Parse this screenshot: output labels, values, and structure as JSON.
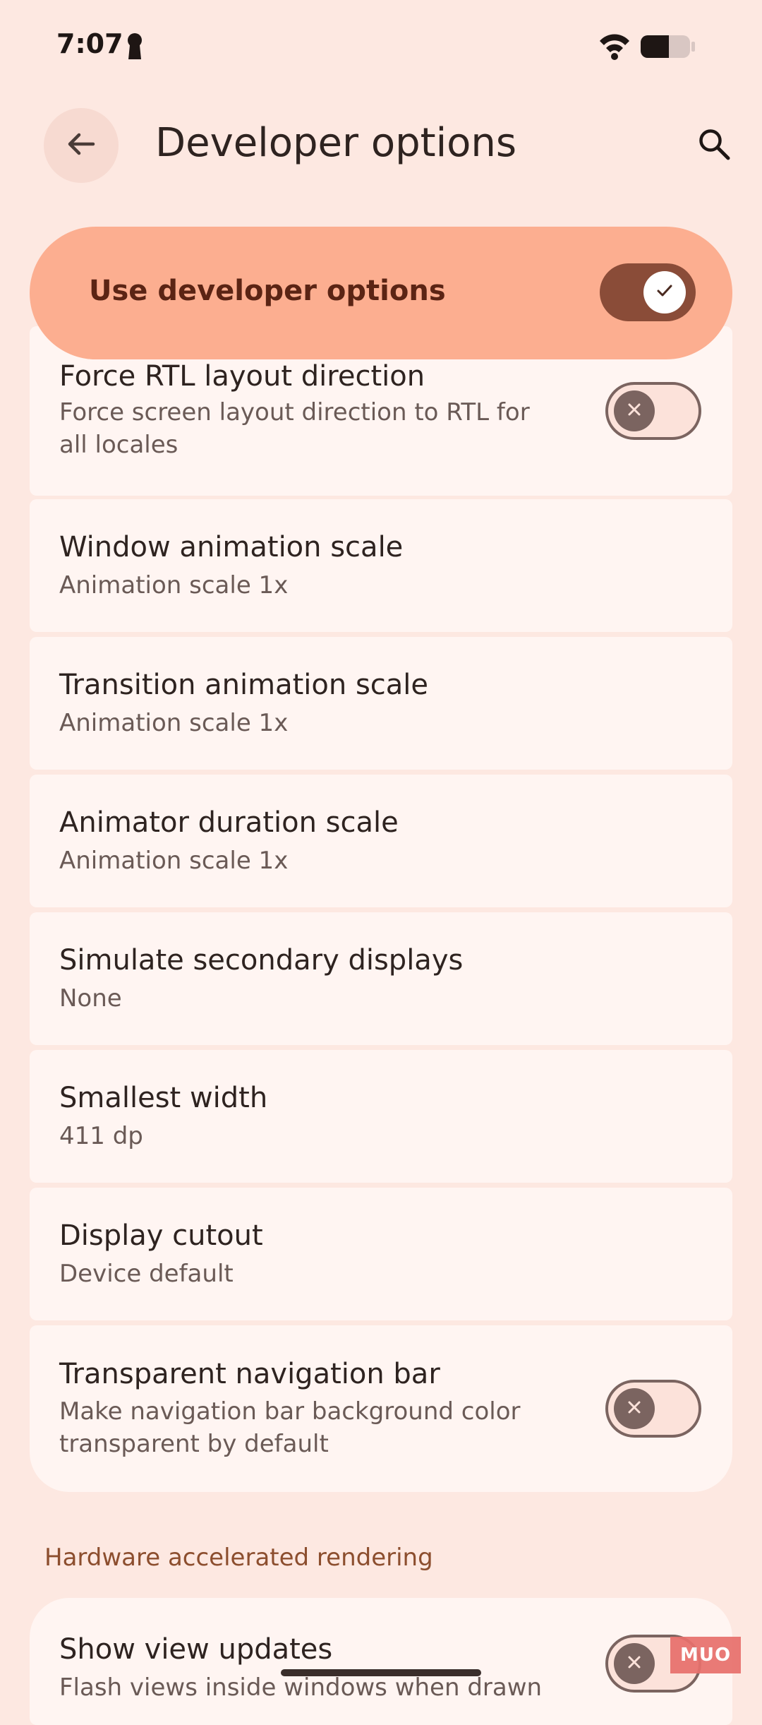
{
  "status_bar": {
    "time": "7:07"
  },
  "header": {
    "title": "Developer options"
  },
  "main_toggle": {
    "label": "Use developer options",
    "state": "on"
  },
  "settings": [
    {
      "title": "Force RTL layout direction",
      "subtitle_lines": [
        "Force screen layout direction to RTL for",
        "all locales"
      ],
      "toggle": "off"
    },
    {
      "title": "Window animation scale",
      "subtitle_lines": [
        "Animation scale 1x"
      ]
    },
    {
      "title": "Transition animation scale",
      "subtitle_lines": [
        "Animation scale 1x"
      ]
    },
    {
      "title": "Animator duration scale",
      "subtitle_lines": [
        "Animation scale 1x"
      ]
    },
    {
      "title": "Simulate secondary displays",
      "subtitle_lines": [
        "None"
      ]
    },
    {
      "title": "Smallest width",
      "subtitle_lines": [
        "411 dp"
      ]
    },
    {
      "title": "Display cutout",
      "subtitle_lines": [
        "Device default"
      ]
    },
    {
      "title": "Transparent navigation bar",
      "subtitle_lines": [
        "Make navigation bar background color",
        "transparent by default"
      ],
      "toggle": "off"
    }
  ],
  "section": {
    "header": "Hardware accelerated rendering",
    "items": [
      {
        "title": "Show view updates",
        "subtitle_lines": [
          "Flash views inside windows when drawn"
        ],
        "toggle": "off"
      }
    ]
  },
  "watermark": "MUO",
  "icons": {
    "back": "arrow-back-icon",
    "search": "search-icon",
    "wifi": "wifi-icon",
    "battery": "battery-icon",
    "status_left": "keyhole-icon"
  },
  "colors": {
    "background": "#FDE8E1",
    "accent_container": "#FCAE90",
    "switch_on": "#8A4C38",
    "section_header": "#8C4E2E"
  }
}
